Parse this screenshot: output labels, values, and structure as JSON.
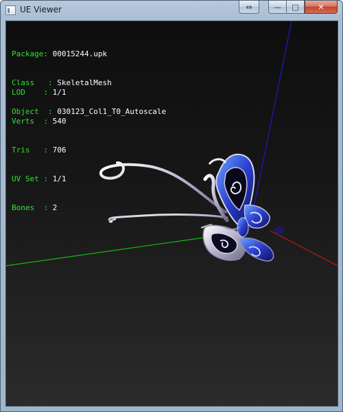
{
  "window": {
    "title": "UE Viewer",
    "buttons": {
      "fullscreen_glyph": "⇔",
      "minimize_glyph": "—",
      "maximize_glyph": "□",
      "close_glyph": "✕"
    }
  },
  "info_block_1": [
    {
      "label": "Package: ",
      "value": "00015244.upk"
    },
    {
      "label": "Class   : ",
      "value": "SkeletalMesh"
    },
    {
      "label": "Object  : ",
      "value": "030123_Col1_T0_Autoscale"
    }
  ],
  "info_block_2": [
    {
      "label": "LOD    : ",
      "value": "1/1"
    },
    {
      "label": "Verts  : ",
      "value": "540"
    },
    {
      "label": "Tris   : ",
      "value": "706"
    },
    {
      "label": "UV Set : ",
      "value": "1/1"
    },
    {
      "label": "Bones  : ",
      "value": "2"
    }
  ],
  "colors": {
    "label_green": "#2fe52f",
    "value_white": "#ffffff",
    "axis_x": "#c01818",
    "axis_y": "#18b818",
    "axis_z": "#1a1ac8",
    "mesh_blue": "#2a3fd0",
    "mesh_silver": "#c8c8d8"
  }
}
